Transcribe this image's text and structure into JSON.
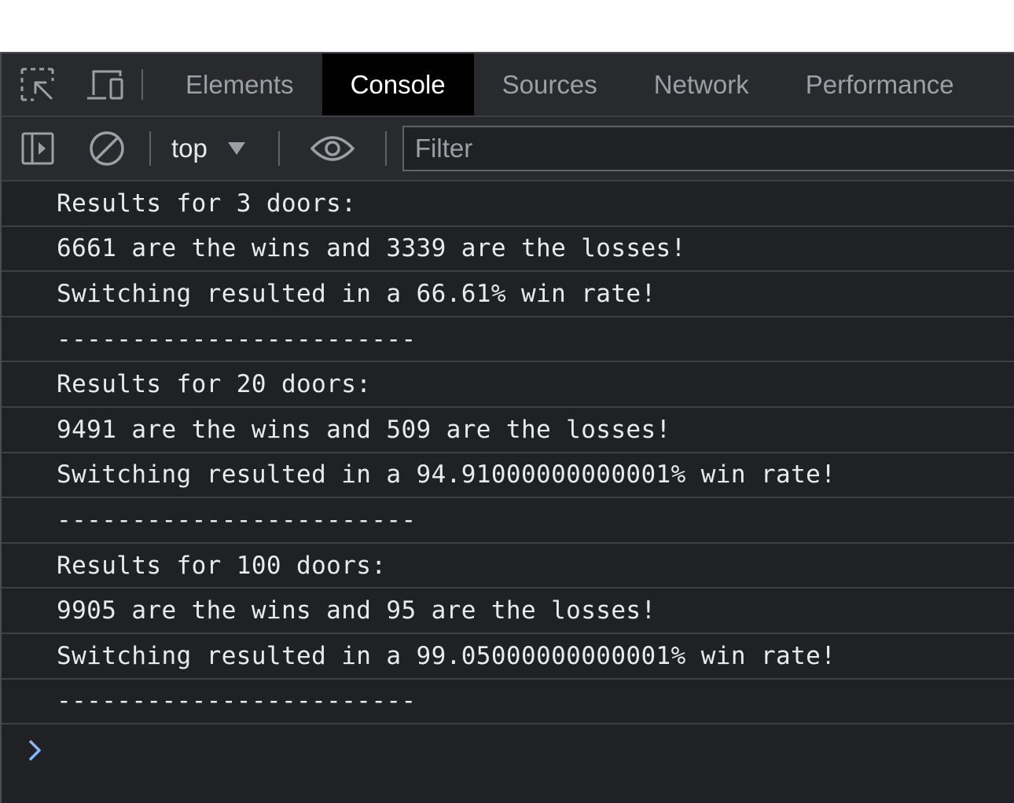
{
  "tabs": [
    {
      "label": "Elements",
      "active": false
    },
    {
      "label": "Console",
      "active": true
    },
    {
      "label": "Sources",
      "active": false
    },
    {
      "label": "Network",
      "active": false
    },
    {
      "label": "Performance",
      "active": false
    }
  ],
  "toolbar": {
    "context": "top",
    "filter_placeholder": "Filter"
  },
  "console_lines": [
    "Results for 3 doors:",
    "6661 are the wins and 3339 are the losses!",
    "Switching resulted in a 66.61% win rate!",
    "------------------------",
    "Results for 20 doors:",
    "9491 are the wins and 509 are the losses!",
    "Switching resulted in a 94.91000000000001% win rate!",
    "------------------------",
    "Results for 100 doors:",
    "9905 are the wins and 95 are the losses!",
    "Switching resulted in a 99.05000000000001% win rate!",
    "------------------------"
  ],
  "icons": {
    "inspect": "inspect-element-icon",
    "device": "device-toolbar-icon",
    "sidebar": "sidebar-toggle-icon",
    "clear": "clear-console-icon",
    "dropdown": "dropdown-arrow-icon",
    "eye": "live-expression-eye-icon",
    "prompt": "console-prompt-chevron-icon"
  },
  "colors": {
    "background": "#202124",
    "toolbar": "#292a2d",
    "text": "#e8eaed",
    "muted": "#9aa0a6",
    "prompt": "#8ab4f8"
  }
}
